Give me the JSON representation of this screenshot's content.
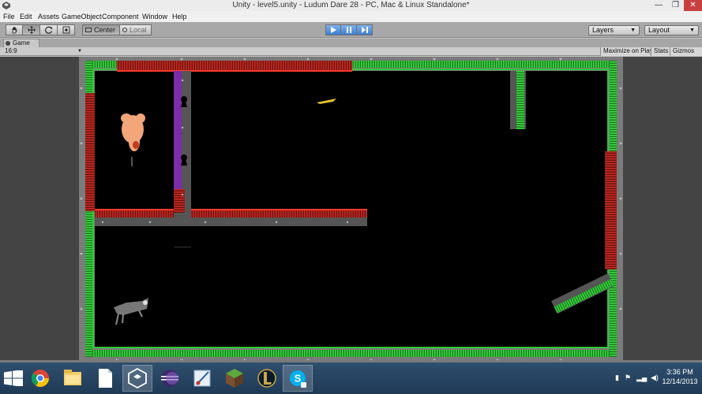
{
  "window": {
    "title": "Unity - level5.unity - Ludum Dare 28 - PC, Mac & Linux Standalone*",
    "minimize": "—",
    "maximize": "❐",
    "close": "✕"
  },
  "menu": {
    "items": [
      "File",
      "Edit",
      "Assets",
      "GameObject",
      "Component",
      "Window",
      "Help"
    ]
  },
  "toolbar": {
    "pivot_label": "Center",
    "space_label": "Local",
    "layers_label": "Layers",
    "layout_label": "Layout"
  },
  "game_view": {
    "tab_label": "Game",
    "aspect": "16:9",
    "maximize_on_play": "Maximize on Play",
    "stats": "Stats",
    "gizmos": "Gizmos"
  },
  "taskbar": {
    "time": "3:36 PM",
    "date": "12/14/2013"
  },
  "colors": {
    "green_wall": "#2fc936",
    "red_wall": "#b3211c",
    "purple_door": "#7a2ea8",
    "level_bg": "#000000",
    "play_button": "#3e7dd0"
  },
  "icons": [
    "unity-logo-icon",
    "hand-tool-icon",
    "move-tool-icon",
    "rotate-tool-icon",
    "scale-tool-icon",
    "play-icon",
    "pause-icon",
    "step-icon",
    "windows-start-icon",
    "chrome-icon",
    "file-explorer-icon",
    "document-icon",
    "unity-icon",
    "eclipse-icon",
    "paint-icon",
    "minecraft-icon",
    "league-of-legends-icon",
    "skype-icon"
  ]
}
